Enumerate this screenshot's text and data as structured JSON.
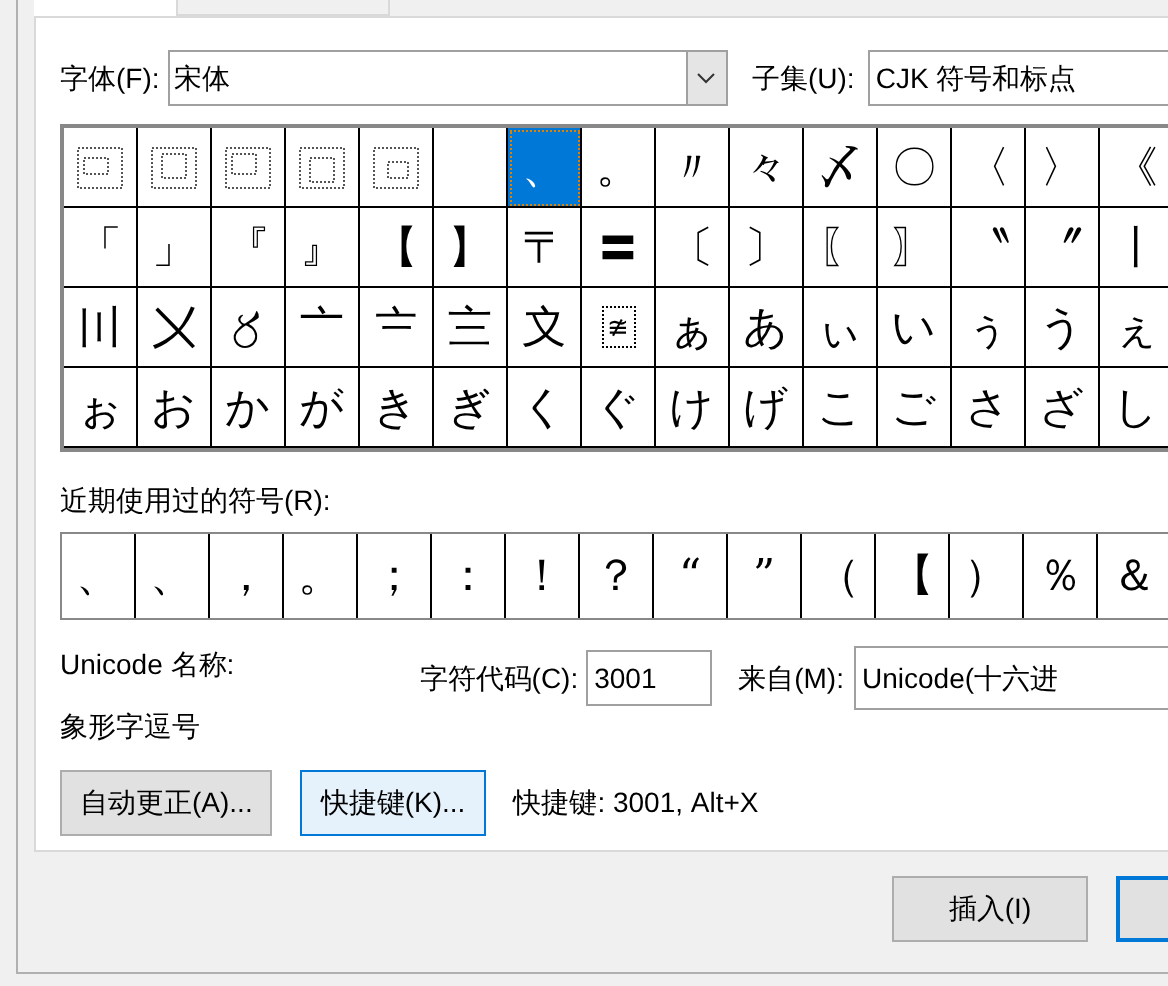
{
  "tabs": [
    {
      "selected": true
    },
    {
      "selected": false
    }
  ],
  "font": {
    "label": "字体(F):",
    "value": "宋体"
  },
  "subset": {
    "label": "子集(U):",
    "value": "CJK 符号和标点"
  },
  "grid": [
    [
      {
        "kind": "missing",
        "selected": false
      },
      {
        "kind": "missing",
        "selected": false
      },
      {
        "kind": "missing",
        "selected": false
      },
      {
        "kind": "missing",
        "selected": false
      },
      {
        "kind": "missing",
        "selected": false
      },
      {
        "kind": "blank",
        "selected": false
      },
      {
        "kind": "glyph",
        "char": "、",
        "selected": true
      },
      {
        "kind": "glyph",
        "char": "。",
        "selected": false
      },
      {
        "kind": "glyph",
        "char": "〃",
        "selected": false
      },
      {
        "kind": "glyph",
        "char": "々",
        "selected": false
      },
      {
        "kind": "glyph",
        "char": "〆",
        "selected": false
      },
      {
        "kind": "glyph",
        "char": "〇",
        "selected": false
      },
      {
        "kind": "glyph",
        "char": "〈",
        "selected": false
      },
      {
        "kind": "glyph",
        "char": "〉",
        "selected": false
      },
      {
        "kind": "glyph",
        "char": "《",
        "selected": false
      }
    ],
    [
      {
        "kind": "glyph",
        "char": "「",
        "selected": false
      },
      {
        "kind": "glyph",
        "char": "」",
        "selected": false
      },
      {
        "kind": "glyph",
        "char": "『",
        "selected": false
      },
      {
        "kind": "glyph",
        "char": "』",
        "selected": false
      },
      {
        "kind": "glyph",
        "char": "【",
        "selected": false
      },
      {
        "kind": "glyph",
        "char": "】",
        "selected": false
      },
      {
        "kind": "glyph",
        "char": "〒",
        "selected": false
      },
      {
        "kind": "glyph",
        "char": "〓",
        "selected": false
      },
      {
        "kind": "glyph",
        "char": "〔",
        "selected": false
      },
      {
        "kind": "glyph",
        "char": "〕",
        "selected": false
      },
      {
        "kind": "glyph",
        "char": "〖",
        "selected": false
      },
      {
        "kind": "glyph",
        "char": "〗",
        "selected": false
      },
      {
        "kind": "glyph",
        "char": "〝",
        "selected": false
      },
      {
        "kind": "glyph",
        "char": "〞",
        "selected": false
      },
      {
        "kind": "glyph",
        "char": "〡",
        "selected": false
      }
    ],
    [
      {
        "kind": "glyph",
        "char": "〣",
        "selected": false
      },
      {
        "kind": "glyph",
        "char": "〤",
        "selected": false
      },
      {
        "kind": "glyph",
        "char": "〥",
        "selected": false
      },
      {
        "kind": "glyph",
        "char": "〦",
        "selected": false
      },
      {
        "kind": "glyph",
        "char": "〧",
        "selected": false
      },
      {
        "kind": "glyph",
        "char": "〨",
        "selected": false
      },
      {
        "kind": "glyph",
        "char": "〩",
        "selected": false
      },
      {
        "kind": "boxed",
        "char": "≇",
        "selected": false
      },
      {
        "kind": "glyph",
        "char": "ぁ",
        "selected": false
      },
      {
        "kind": "glyph",
        "char": "あ",
        "selected": false
      },
      {
        "kind": "glyph",
        "char": "ぃ",
        "selected": false
      },
      {
        "kind": "glyph",
        "char": "い",
        "selected": false
      },
      {
        "kind": "glyph",
        "char": "ぅ",
        "selected": false
      },
      {
        "kind": "glyph",
        "char": "う",
        "selected": false
      },
      {
        "kind": "glyph",
        "char": "ぇ",
        "selected": false
      }
    ],
    [
      {
        "kind": "glyph",
        "char": "ぉ",
        "selected": false
      },
      {
        "kind": "glyph",
        "char": "お",
        "selected": false
      },
      {
        "kind": "glyph",
        "char": "か",
        "selected": false
      },
      {
        "kind": "glyph",
        "char": "が",
        "selected": false
      },
      {
        "kind": "glyph",
        "char": "き",
        "selected": false
      },
      {
        "kind": "glyph",
        "char": "ぎ",
        "selected": false
      },
      {
        "kind": "glyph",
        "char": "く",
        "selected": false
      },
      {
        "kind": "glyph",
        "char": "ぐ",
        "selected": false
      },
      {
        "kind": "glyph",
        "char": "け",
        "selected": false
      },
      {
        "kind": "glyph",
        "char": "げ",
        "selected": false
      },
      {
        "kind": "glyph",
        "char": "こ",
        "selected": false
      },
      {
        "kind": "glyph",
        "char": "ご",
        "selected": false
      },
      {
        "kind": "glyph",
        "char": "さ",
        "selected": false
      },
      {
        "kind": "glyph",
        "char": "ざ",
        "selected": false
      },
      {
        "kind": "glyph",
        "char": "し",
        "selected": false
      }
    ]
  ],
  "recent": {
    "label": "近期使用过的符号(R):",
    "symbols": [
      "、",
      "、",
      "，",
      "。",
      "；",
      "：",
      "！",
      "？",
      "“",
      "”",
      "（",
      "【",
      "）",
      "％",
      "＆"
    ]
  },
  "unicode_name": {
    "label": "Unicode 名称:",
    "value": "象形字逗号"
  },
  "char_code": {
    "label": "字符代码(C):",
    "value": "3001"
  },
  "from": {
    "label": "来自(M):",
    "value": "Unicode(十六进"
  },
  "buttons": [
    {
      "label": "自动更正(A)...",
      "focused": false
    },
    {
      "label": "快捷键(K)...",
      "focused": true
    }
  ],
  "shortcut": "快捷键: 3001, Alt+X",
  "insert_button": "插入(I)"
}
